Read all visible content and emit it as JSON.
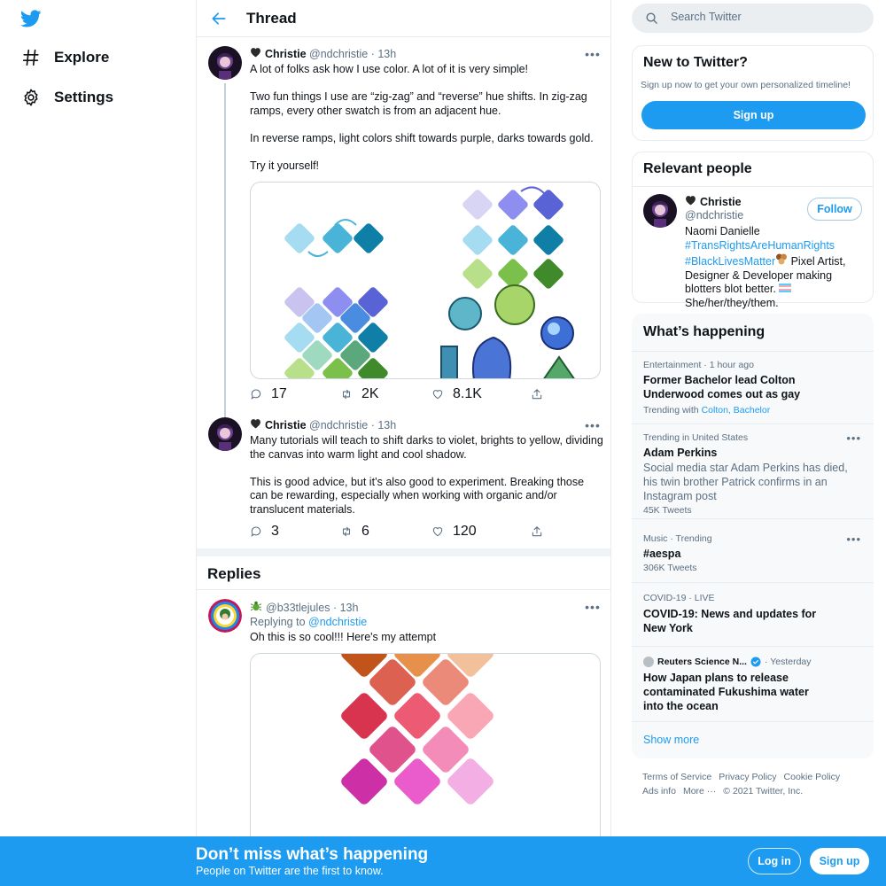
{
  "nav": {
    "items": [
      {
        "label": "Explore",
        "icon": "hashtag-icon"
      },
      {
        "label": "Settings",
        "icon": "gear-icon"
      }
    ]
  },
  "thread": {
    "title": "Thread",
    "tweets": [
      {
        "author": "Christie",
        "handle": "@ndchristie",
        "time": "· 13h",
        "paragraphs": [
          "A lot of folks ask how I use color. A lot of it is very simple!",
          "Two fun things I use are “zig-zag” and “reverse” hue shifts.  In zig-zag ramps, every other swatch is from an adjacent hue.",
          "In reverse ramps, light colors shift towards purple, darks towards gold.",
          "Try it yourself!"
        ],
        "replies": "17",
        "retweets": "2K",
        "likes": "8.1K"
      },
      {
        "author": "Christie",
        "handle": "@ndchristie",
        "time": "· 13h",
        "paragraphs": [
          "Many tutorials will teach to shift darks to violet, brights to yellow, dividing the canvas into warm light and cool shadow.",
          "This is good advice, but it’s also good to experiment.  Breaking those can be rewarding, especially when working with organic and/or translucent materials."
        ],
        "replies": "3",
        "retweets": "6",
        "likes": "120"
      }
    ]
  },
  "replies": {
    "title": "Replies",
    "items": [
      {
        "handle": "@b33tlejules",
        "time": "· 13h",
        "replying_label": "Replying to",
        "replying_to": "@ndchristie",
        "text": "Oh this is so cool!!! Here's my attempt"
      }
    ]
  },
  "search": {
    "placeholder": "Search Twitter"
  },
  "new_to_twitter": {
    "title": "New to Twitter?",
    "subtitle": "Sign up now to get your own personalized timeline!",
    "button": "Sign up"
  },
  "relevant_people": {
    "title": "Relevant people",
    "name": "Christie",
    "handle": "@ndchristie",
    "follow": "Follow",
    "bio_line1": "Naomi Danielle",
    "bio_tag1": "#TransRightsAreHumanRights",
    "bio_tag2": "#BlackLivesMatter",
    "bio_rest": " Pixel Artist, Designer & Developer making blotters blot better. ",
    "bio_pronouns": " She/her/they/them."
  },
  "happening": {
    "title": "What’s happening",
    "trends": [
      {
        "meta": "Entertainment · 1 hour ago",
        "title": "Former Bachelor lead Colton Underwood comes out as gay",
        "trending_label": "Trending with",
        "trending_links": "Colton, Bachelor"
      },
      {
        "meta": "Trending in United States",
        "title": "Adam Perkins",
        "desc": "Social media star Adam Perkins has died, his twin brother Patrick confirms in an Instagram post",
        "count": "45K Tweets"
      },
      {
        "meta": "Music · Trending",
        "title": "#aespa",
        "count": "306K Tweets"
      },
      {
        "meta": "COVID-19 · LIVE",
        "title": "COVID-19: News and updates for New York"
      },
      {
        "source": "Reuters Science N...",
        "time": "· Yesterday",
        "title": "How Japan plans to release contaminated Fukushima water into the ocean"
      }
    ],
    "show_more": "Show more"
  },
  "footer": {
    "links": [
      "Terms of Service",
      "Privacy Policy",
      "Cookie Policy",
      "Ads info",
      "More ···",
      "© 2021 Twitter, Inc."
    ]
  },
  "banner": {
    "title": "Don’t miss what’s happening",
    "subtitle": "People on Twitter are the first to know.",
    "login": "Log in",
    "signup": "Sign up"
  },
  "colors": {
    "accent": "#1d9bf0",
    "text": "#0f1419",
    "muted": "#5b7083",
    "border": "#e6ecf0"
  }
}
